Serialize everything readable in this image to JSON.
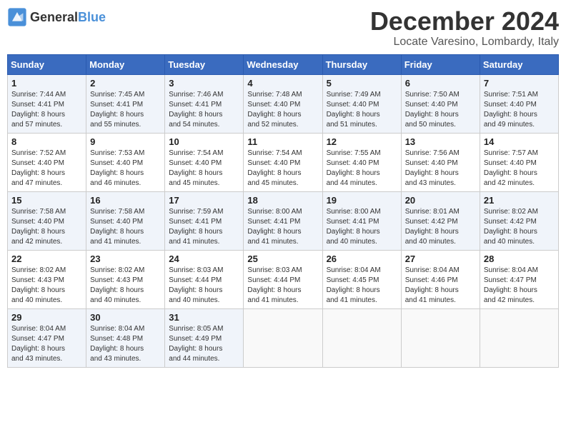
{
  "header": {
    "logo_general": "General",
    "logo_blue": "Blue",
    "month_title": "December 2024",
    "location": "Locate Varesino, Lombardy, Italy"
  },
  "calendar": {
    "days_of_week": [
      "Sunday",
      "Monday",
      "Tuesday",
      "Wednesday",
      "Thursday",
      "Friday",
      "Saturday"
    ],
    "weeks": [
      [
        {
          "day": "",
          "info": ""
        },
        {
          "day": "2",
          "info": "Sunrise: 7:45 AM\nSunset: 4:41 PM\nDaylight: 8 hours\nand 55 minutes."
        },
        {
          "day": "3",
          "info": "Sunrise: 7:46 AM\nSunset: 4:41 PM\nDaylight: 8 hours\nand 54 minutes."
        },
        {
          "day": "4",
          "info": "Sunrise: 7:48 AM\nSunset: 4:40 PM\nDaylight: 8 hours\nand 52 minutes."
        },
        {
          "day": "5",
          "info": "Sunrise: 7:49 AM\nSunset: 4:40 PM\nDaylight: 8 hours\nand 51 minutes."
        },
        {
          "day": "6",
          "info": "Sunrise: 7:50 AM\nSunset: 4:40 PM\nDaylight: 8 hours\nand 50 minutes."
        },
        {
          "day": "7",
          "info": "Sunrise: 7:51 AM\nSunset: 4:40 PM\nDaylight: 8 hours\nand 49 minutes."
        }
      ],
      [
        {
          "day": "1",
          "info": "Sunrise: 7:44 AM\nSunset: 4:41 PM\nDaylight: 8 hours\nand 57 minutes."
        },
        {
          "day": "",
          "info": ""
        },
        {
          "day": "",
          "info": ""
        },
        {
          "day": "",
          "info": ""
        },
        {
          "day": "",
          "info": ""
        },
        {
          "day": "",
          "info": ""
        },
        {
          "day": "",
          "info": ""
        }
      ],
      [
        {
          "day": "8",
          "info": "Sunrise: 7:52 AM\nSunset: 4:40 PM\nDaylight: 8 hours\nand 47 minutes."
        },
        {
          "day": "9",
          "info": "Sunrise: 7:53 AM\nSunset: 4:40 PM\nDaylight: 8 hours\nand 46 minutes."
        },
        {
          "day": "10",
          "info": "Sunrise: 7:54 AM\nSunset: 4:40 PM\nDaylight: 8 hours\nand 45 minutes."
        },
        {
          "day": "11",
          "info": "Sunrise: 7:54 AM\nSunset: 4:40 PM\nDaylight: 8 hours\nand 45 minutes."
        },
        {
          "day": "12",
          "info": "Sunrise: 7:55 AM\nSunset: 4:40 PM\nDaylight: 8 hours\nand 44 minutes."
        },
        {
          "day": "13",
          "info": "Sunrise: 7:56 AM\nSunset: 4:40 PM\nDaylight: 8 hours\nand 43 minutes."
        },
        {
          "day": "14",
          "info": "Sunrise: 7:57 AM\nSunset: 4:40 PM\nDaylight: 8 hours\nand 42 minutes."
        }
      ],
      [
        {
          "day": "15",
          "info": "Sunrise: 7:58 AM\nSunset: 4:40 PM\nDaylight: 8 hours\nand 42 minutes."
        },
        {
          "day": "16",
          "info": "Sunrise: 7:58 AM\nSunset: 4:40 PM\nDaylight: 8 hours\nand 41 minutes."
        },
        {
          "day": "17",
          "info": "Sunrise: 7:59 AM\nSunset: 4:41 PM\nDaylight: 8 hours\nand 41 minutes."
        },
        {
          "day": "18",
          "info": "Sunrise: 8:00 AM\nSunset: 4:41 PM\nDaylight: 8 hours\nand 41 minutes."
        },
        {
          "day": "19",
          "info": "Sunrise: 8:00 AM\nSunset: 4:41 PM\nDaylight: 8 hours\nand 40 minutes."
        },
        {
          "day": "20",
          "info": "Sunrise: 8:01 AM\nSunset: 4:42 PM\nDaylight: 8 hours\nand 40 minutes."
        },
        {
          "day": "21",
          "info": "Sunrise: 8:02 AM\nSunset: 4:42 PM\nDaylight: 8 hours\nand 40 minutes."
        }
      ],
      [
        {
          "day": "22",
          "info": "Sunrise: 8:02 AM\nSunset: 4:43 PM\nDaylight: 8 hours\nand 40 minutes."
        },
        {
          "day": "23",
          "info": "Sunrise: 8:02 AM\nSunset: 4:43 PM\nDaylight: 8 hours\nand 40 minutes."
        },
        {
          "day": "24",
          "info": "Sunrise: 8:03 AM\nSunset: 4:44 PM\nDaylight: 8 hours\nand 40 minutes."
        },
        {
          "day": "25",
          "info": "Sunrise: 8:03 AM\nSunset: 4:44 PM\nDaylight: 8 hours\nand 41 minutes."
        },
        {
          "day": "26",
          "info": "Sunrise: 8:04 AM\nSunset: 4:45 PM\nDaylight: 8 hours\nand 41 minutes."
        },
        {
          "day": "27",
          "info": "Sunrise: 8:04 AM\nSunset: 4:46 PM\nDaylight: 8 hours\nand 41 minutes."
        },
        {
          "day": "28",
          "info": "Sunrise: 8:04 AM\nSunset: 4:47 PM\nDaylight: 8 hours\nand 42 minutes."
        }
      ],
      [
        {
          "day": "29",
          "info": "Sunrise: 8:04 AM\nSunset: 4:47 PM\nDaylight: 8 hours\nand 43 minutes."
        },
        {
          "day": "30",
          "info": "Sunrise: 8:04 AM\nSunset: 4:48 PM\nDaylight: 8 hours\nand 43 minutes."
        },
        {
          "day": "31",
          "info": "Sunrise: 8:05 AM\nSunset: 4:49 PM\nDaylight: 8 hours\nand 44 minutes."
        },
        {
          "day": "",
          "info": ""
        },
        {
          "day": "",
          "info": ""
        },
        {
          "day": "",
          "info": ""
        },
        {
          "day": "",
          "info": ""
        }
      ]
    ]
  }
}
